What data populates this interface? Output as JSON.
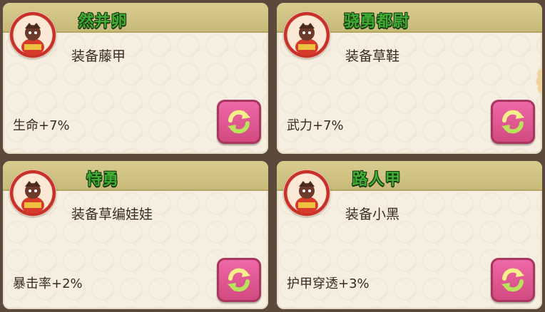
{
  "cards": [
    {
      "title": "然并卵",
      "equip": "装备藤甲",
      "stat": "生命+7%"
    },
    {
      "title": "骁勇都尉",
      "equip": "装备草鞋",
      "stat": "武力+7%"
    },
    {
      "title": "恃勇",
      "equip": "装备草编娃娃",
      "stat": "暴击率+2%"
    },
    {
      "title": "路人甲",
      "equip": "装备小黑",
      "stat": "护甲穿透+3%"
    }
  ],
  "icons": {
    "avatar": "general-portrait-icon",
    "refresh": "refresh-arrows-icon"
  },
  "colors": {
    "title_green": "#3fae32",
    "button_pink": "#e05a93",
    "card_bg": "#f6efe1",
    "header_bg": "#d3c584"
  }
}
